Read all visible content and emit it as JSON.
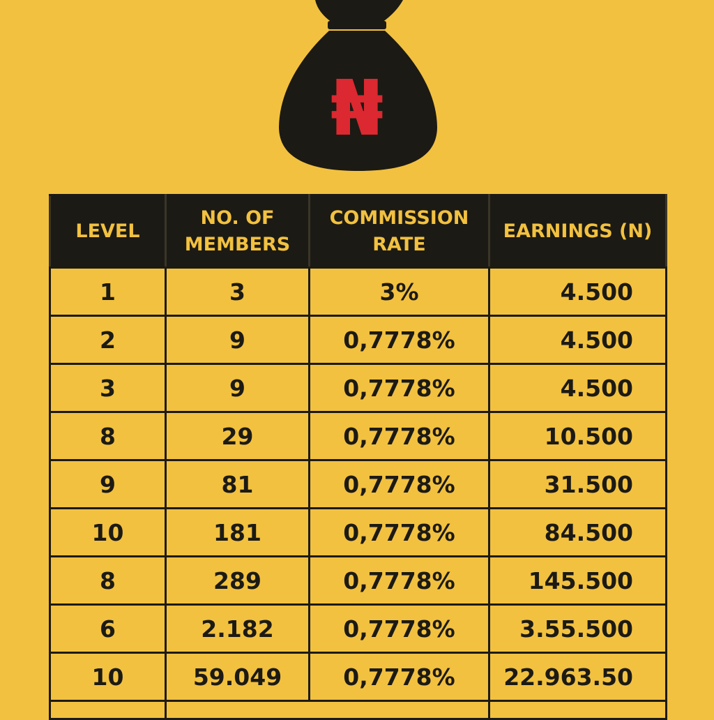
{
  "bag": {
    "icon": "naira-money-bag-icon",
    "symbol": "₦",
    "colors": {
      "bag": "#1c1a14",
      "symbol": "#dc2830"
    }
  },
  "colors": {
    "background": "#f2c140",
    "header_bg": "#1c1a14",
    "header_text": "#f2c140",
    "cell_text": "#1c1a14",
    "grid": "#1c1a14"
  },
  "chart_data": {
    "type": "table",
    "columns": [
      "LEVEL",
      "NO. OF MEMBERS",
      "COMMISSION RATE",
      "EARNINGS (N)"
    ],
    "header_lines": [
      [
        "LEVEL"
      ],
      [
        "NO. OF",
        "MEMBERS"
      ],
      [
        "COMMISSION",
        "RATE"
      ],
      [
        "EARNINGS (N)"
      ]
    ],
    "rows": [
      [
        "1",
        "3",
        "3%",
        "4.500"
      ],
      [
        "2",
        "9",
        "0,7778%",
        "4.500"
      ],
      [
        "3",
        "9",
        "0,7778%",
        "4.500"
      ],
      [
        "8",
        "29",
        "0,7778%",
        "10.500"
      ],
      [
        "9",
        "81",
        "0,7778%",
        "31.500"
      ],
      [
        "10",
        "181",
        "0,7778%",
        "84.500"
      ],
      [
        "8",
        "289",
        "0,7778%",
        "145.500"
      ],
      [
        "6",
        "2.182",
        "0,7778%",
        "3.55.500"
      ],
      [
        "10",
        "59.049",
        "0,7778%",
        "22.963.50"
      ]
    ]
  }
}
